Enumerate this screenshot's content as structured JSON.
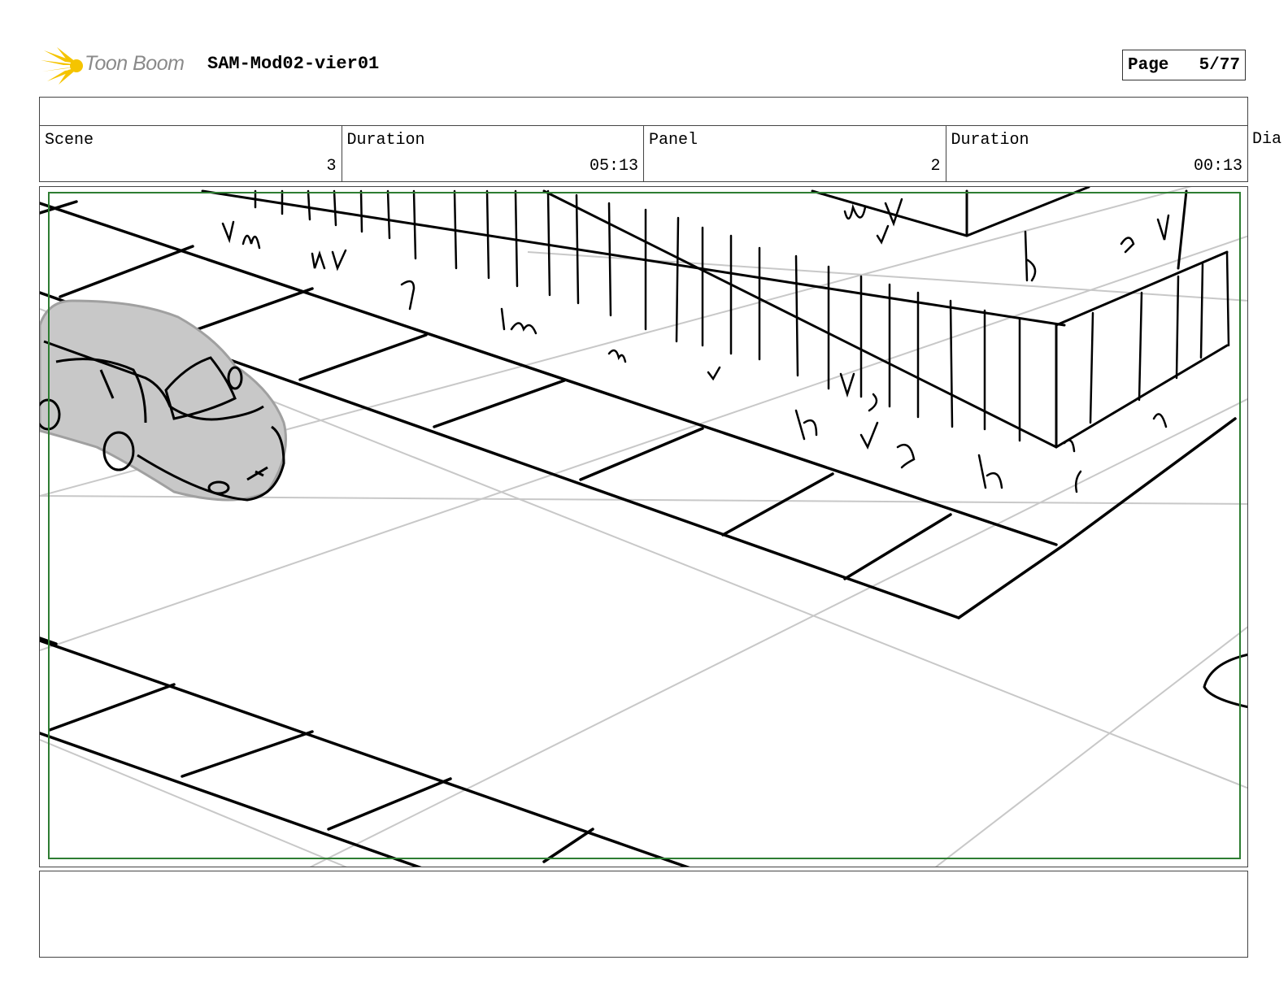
{
  "header": {
    "logo_text": "Toon Boom",
    "project_name": "SAM-Mod02-vier01",
    "page_label": "Page",
    "page_number": "5/77"
  },
  "info": {
    "scene_label": "Scene",
    "scene_value": "3",
    "scene_duration_label": "Duration",
    "scene_duration_value": "05:13",
    "panel_label": "Panel",
    "panel_value": "2",
    "panel_duration_label": "Duration",
    "panel_duration_value": "00:13",
    "dialog_label": "Dia"
  },
  "panel_image": {
    "description_icon": "storyboard-sketch",
    "frame_color": "#2e7d32",
    "sketch_color": "#000000",
    "guide_color": "#c8c8c8",
    "car_fill": "#c8c8c8"
  },
  "notes": {
    "text": ""
  }
}
